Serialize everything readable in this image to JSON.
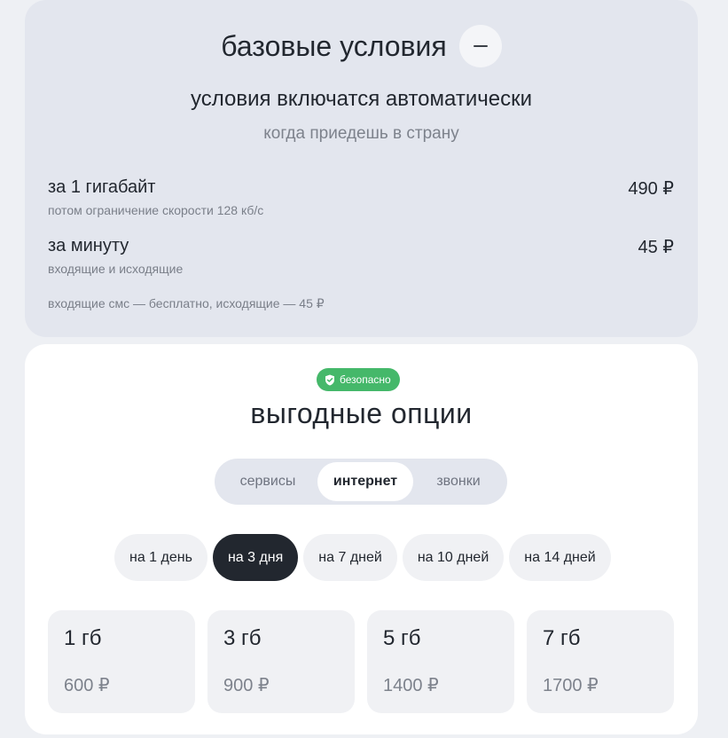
{
  "basic": {
    "title": "базовые условия",
    "auto_title": "условия включатся автоматически",
    "auto_subtitle": "когда приедешь в страну",
    "rates": [
      {
        "label": "за 1 гигабайт",
        "note": "потом ограничение скорости 128 кб/с",
        "price": "490 ₽"
      },
      {
        "label": "за минуту",
        "note": "входящие и исходящие",
        "price": "45 ₽"
      }
    ],
    "sms_note": "входящие смс — бесплатно, исходящие — 45 ₽"
  },
  "options": {
    "badge": "безопасно",
    "title": "выгодные опции",
    "tabs": [
      {
        "label": "сервисы",
        "active": false
      },
      {
        "label": "интернет",
        "active": true
      },
      {
        "label": "звонки",
        "active": false
      }
    ],
    "durations": [
      {
        "label": "на 1 день",
        "active": false
      },
      {
        "label": "на 3 дня",
        "active": true
      },
      {
        "label": "на 7 дней",
        "active": false
      },
      {
        "label": "на 10 дней",
        "active": false
      },
      {
        "label": "на 14 дней",
        "active": false
      }
    ],
    "plans": [
      {
        "gb": "1 гб",
        "price": "600 ₽"
      },
      {
        "gb": "3 гб",
        "price": "900 ₽"
      },
      {
        "gb": "5 гб",
        "price": "1400 ₽"
      },
      {
        "gb": "7 гб",
        "price": "1700 ₽"
      }
    ]
  },
  "colors": {
    "background": "#eef0f4",
    "basic_card": "#e3e6ee",
    "accent_dark": "#22272f",
    "badge_green": "#45b86a"
  },
  "icons": {
    "collapse": "minus-icon",
    "badge": "shield-check-icon"
  }
}
